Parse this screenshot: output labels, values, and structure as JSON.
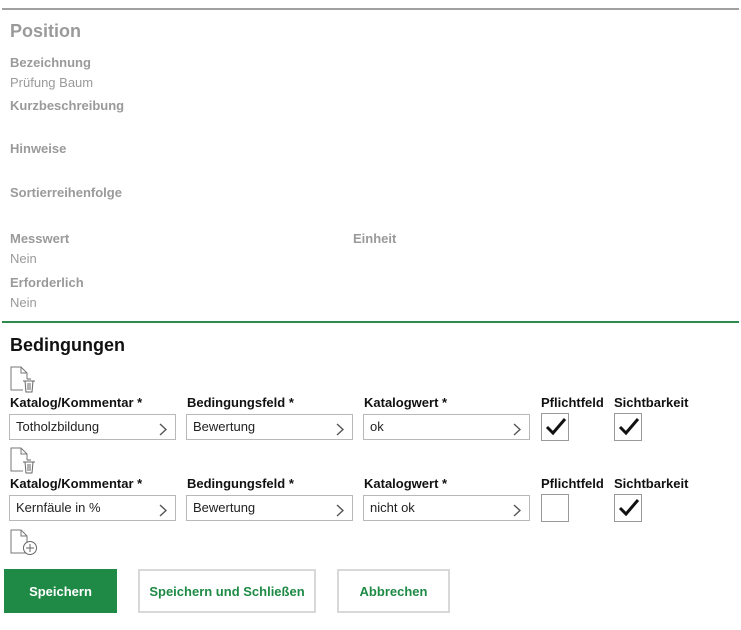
{
  "position": {
    "title": "Position",
    "bezeichnung_label": "Bezeichnung",
    "bezeichnung_value": "Prüfung Baum",
    "kurzbeschreibung_label": "Kurzbeschreibung",
    "hinweise_label": "Hinweise",
    "sortierreihenfolge_label": "Sortierreihenfolge",
    "messwert_label": "Messwert",
    "messwert_value": "Nein",
    "einheit_label": "Einheit",
    "erforderlich_label": "Erforderlich",
    "erforderlich_value": "Nein"
  },
  "bedingungen": {
    "title": "Bedingungen",
    "columns": {
      "katalog": "Katalog/Kommentar *",
      "bedingungsfeld": "Bedingungsfeld *",
      "katalogwert": "Katalogwert *",
      "pflichtfeld": "Pflichtfeld",
      "sichtbarkeit": "Sichtbarkeit"
    },
    "rows": [
      {
        "katalog": "Totholzbildung",
        "bedingungsfeld": "Bewertung",
        "katalogwert": "ok",
        "pflichtfeld": true,
        "sichtbarkeit": true
      },
      {
        "katalog": "Kernfäule in %",
        "bedingungsfeld": "Bewertung",
        "katalogwert": "nicht ok",
        "pflichtfeld": false,
        "sichtbarkeit": true
      }
    ]
  },
  "buttons": {
    "save": "Speichern",
    "save_close": "Speichern und Schließen",
    "cancel": "Abbrechen"
  },
  "colors": {
    "accent": "#1e8a45",
    "muted": "#9a9a9a"
  },
  "icons": [
    "document-delete-icon",
    "document-add-icon",
    "chevron-right-icon",
    "checkmark-icon"
  ]
}
